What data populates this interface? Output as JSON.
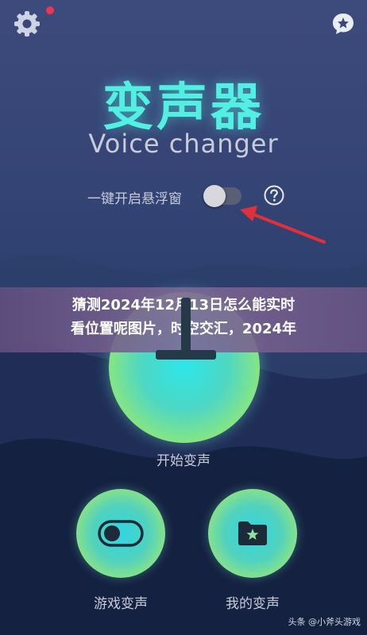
{
  "header": {
    "settings_icon": "gear-icon",
    "notification_color": "#f0344f",
    "feedback_icon": "star-speech-bubble-icon"
  },
  "app": {
    "title_cn": "变声器",
    "title_en": "Voice changer",
    "title_color": "#52f0e2"
  },
  "floating_window": {
    "label": "一键开启悬浮窗",
    "toggle_on": false,
    "help_icon": "question-circle-icon"
  },
  "annotation": {
    "arrow_color": "#e0303a"
  },
  "banner": {
    "line1": "猜测2024年12月13日怎么能实时",
    "line2": "看位置呢图片，时空交汇，2024年"
  },
  "main_action": {
    "label": "开始变声",
    "icon": "plus-icon"
  },
  "actions": [
    {
      "label": "游戏变声",
      "icon": "toggle-switch-icon"
    },
    {
      "label": "我的变声",
      "icon": "folder-star-icon"
    }
  ],
  "watermark": "头条 @小斧头游戏",
  "colors": {
    "text": "#c7ccda",
    "accent_green": "#a6ea5e",
    "accent_cyan": "#2ee6e8"
  }
}
